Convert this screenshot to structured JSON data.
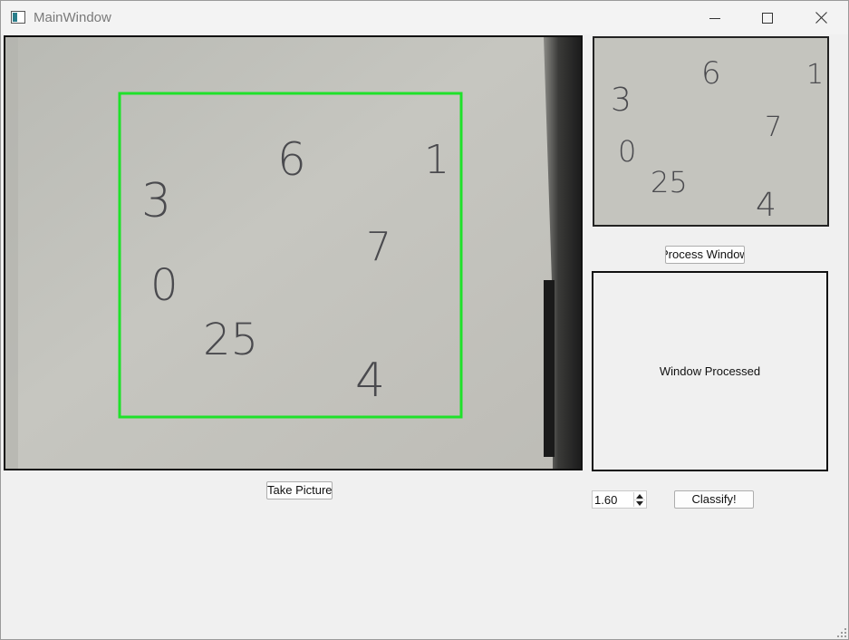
{
  "window": {
    "title": "MainWindow"
  },
  "camera": {
    "digits": [
      "3",
      "6",
      "1",
      "7",
      "0",
      "25",
      "4"
    ],
    "roi_color": "#1fe12a"
  },
  "preview": {
    "digits": [
      "3",
      "6",
      "1",
      "7",
      "0",
      "25",
      "4"
    ]
  },
  "buttons": {
    "process_label": "Process Window",
    "take_label": "Take Picture",
    "classify_label": "Classify!"
  },
  "result": {
    "text": "Window Processed"
  },
  "threshold": {
    "value": "1.60"
  },
  "icons": {
    "app": "app-window-icon",
    "minimize": "minimize-icon",
    "maximize": "maximize-icon",
    "close": "close-icon",
    "spin_up": "chevron-up-icon",
    "spin_down": "chevron-down-icon",
    "resize": "resize-grip-icon"
  }
}
